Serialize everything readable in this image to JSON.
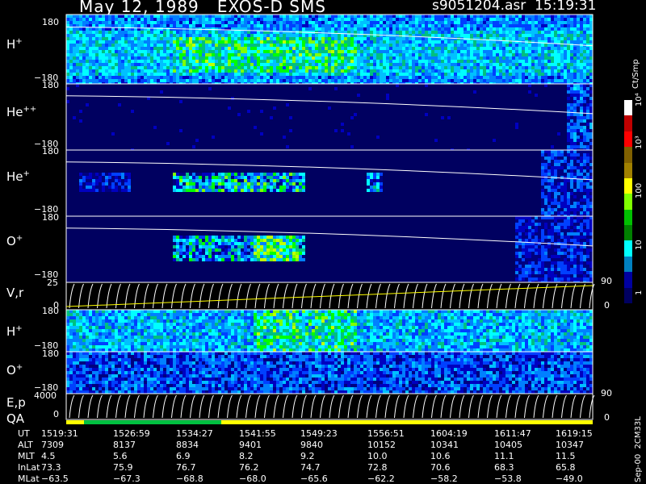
{
  "header": {
    "title": "May 12, 1989   EXOS-D SMS",
    "file": "s9051204.asr",
    "time": "15:19:31"
  },
  "panels": {
    "h_plus": {
      "label": "H",
      "sup": "+",
      "top": "180",
      "bottom": "−180"
    },
    "he_pp": {
      "label": "He",
      "sup": "++",
      "top": "180",
      "bottom": "−180"
    },
    "he_plus": {
      "label": "He",
      "sup": "+",
      "top": "180",
      "bottom": "−180"
    },
    "o_plus": {
      "label": "O",
      "sup": "+",
      "top": "180",
      "bottom": "−180"
    },
    "vr": {
      "label": "V,r",
      "top": "25",
      "bottom": "0",
      "right_top": "90",
      "right_bottom": "0"
    },
    "h_plus2": {
      "label": "H",
      "sup": "+",
      "top": "180",
      "bottom": "−180"
    },
    "o_plus2": {
      "label": "O",
      "sup": "+",
      "top": "180",
      "bottom": "−180"
    },
    "ep": {
      "label": "E,p",
      "top": "4000",
      "bottom": "0",
      "right_top": "90",
      "right_bottom": "0"
    },
    "qa": {
      "label": "QA"
    }
  },
  "colorbar": {
    "unit": "Ct/Smp",
    "ticks": [
      "10⁴",
      "10³",
      "100",
      "10",
      "1"
    ],
    "colors": [
      "#ffffff",
      "#c00000",
      "#ff0000",
      "#806000",
      "#a08000",
      "#ffff00",
      "#80ff00",
      "#00c000",
      "#008000",
      "#00ffff",
      "#0080c0",
      "#0000a0",
      "#000060"
    ]
  },
  "side_note": "Sep-00  2CM33L",
  "chart_data": {
    "type": "table",
    "columns": [
      "UT",
      "ALT",
      "MLT",
      "InLat",
      "MLat"
    ],
    "rows": [
      {
        "UT": "1519:31",
        "ALT": "7309",
        "MLT": "4.5",
        "InLat": "73.3",
        "MLat": "−63.5"
      },
      {
        "UT": "1526:59",
        "ALT": "8137",
        "MLT": "5.6",
        "InLat": "75.9",
        "MLat": "−67.3"
      },
      {
        "UT": "1534:27",
        "ALT": "8834",
        "MLT": "6.9",
        "InLat": "76.7",
        "MLat": "−68.8"
      },
      {
        "UT": "1541:55",
        "ALT": "9401",
        "MLT": "8.2",
        "InLat": "76.2",
        "MLat": "−68.0"
      },
      {
        "UT": "1549:23",
        "ALT": "9840",
        "MLT": "9.2",
        "InLat": "74.7",
        "MLat": "−65.6"
      },
      {
        "UT": "1556:51",
        "ALT": "10152",
        "MLT": "10.0",
        "InLat": "72.8",
        "MLat": "−62.2"
      },
      {
        "UT": "1604:19",
        "ALT": "10341",
        "MLT": "10.6",
        "InLat": "70.6",
        "MLat": "−58.2"
      },
      {
        "UT": "1611:47",
        "ALT": "10405",
        "MLT": "11.1",
        "InLat": "68.3",
        "MLat": "−53.8"
      },
      {
        "UT": "1619:15",
        "ALT": "10347",
        "MLT": "11.5",
        "InLat": "65.8",
        "MLat": "−49.0"
      }
    ]
  }
}
